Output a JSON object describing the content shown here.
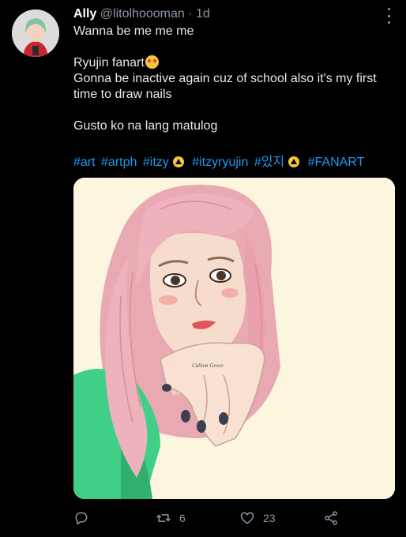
{
  "tweet": {
    "display_name": "Ally",
    "handle": "@litolhoooman",
    "separator": "·",
    "time": "1d",
    "lines": {
      "line1": "Wanna be me me me",
      "line2": "Ryujin fanart",
      "line3": "Gonna be inactive again cuz of school also it's my first time to draw nails",
      "line4": "Gusto ko na lang matulog"
    },
    "hashtags": {
      "h1": "#art",
      "h2": "#artph",
      "h3": "#itzy",
      "h4": "#itzyryujin",
      "h5": "#있지",
      "h6": "#FANART"
    },
    "image_watermark": "Callum Green",
    "emoji": "smiling-face-with-heart-eyes",
    "tag_icon": "itzy-emblem-icon"
  },
  "actions": {
    "reply_icon": "reply-icon",
    "retweet_icon": "retweet-icon",
    "retweet_count": "6",
    "like_icon": "heart-icon",
    "like_count": "23",
    "share_icon": "share-icon"
  },
  "colors": {
    "background": "#000000",
    "text": "#e7e9ea",
    "secondary": "#8b98a5",
    "link": "#1d9bf0",
    "image_bg": "#fdf6df"
  }
}
